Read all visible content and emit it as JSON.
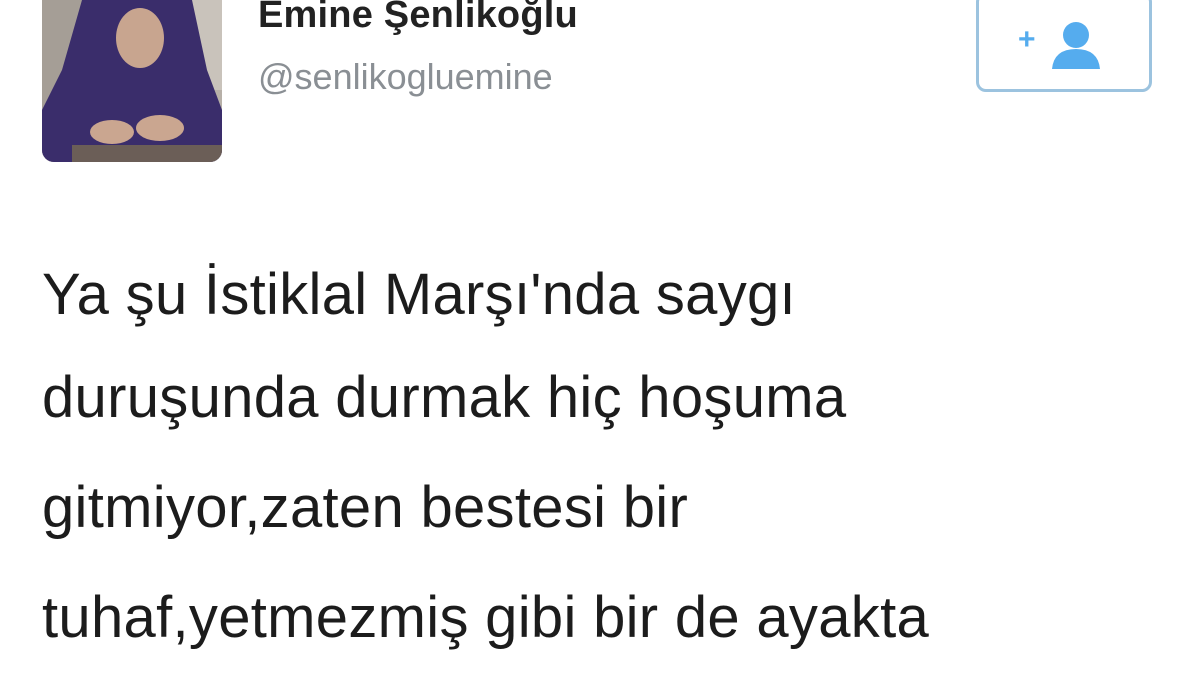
{
  "tweet": {
    "author": {
      "display_name": "Emine Şenlikoğlu",
      "handle": "@senlikogluemine",
      "avatar": "profile-photo"
    },
    "follow_button": {
      "icon": "add-user-icon",
      "plus": "+",
      "accent": "#55acee"
    },
    "text_lines": [
      "Ya şu İstiklal Marşı'nda saygı",
      "duruşunda durmak hiç hoşuma",
      "gitmiyor,zaten bestesi bir",
      "tuhaf,yetmezmiş gibi bir de ayakta"
    ]
  }
}
